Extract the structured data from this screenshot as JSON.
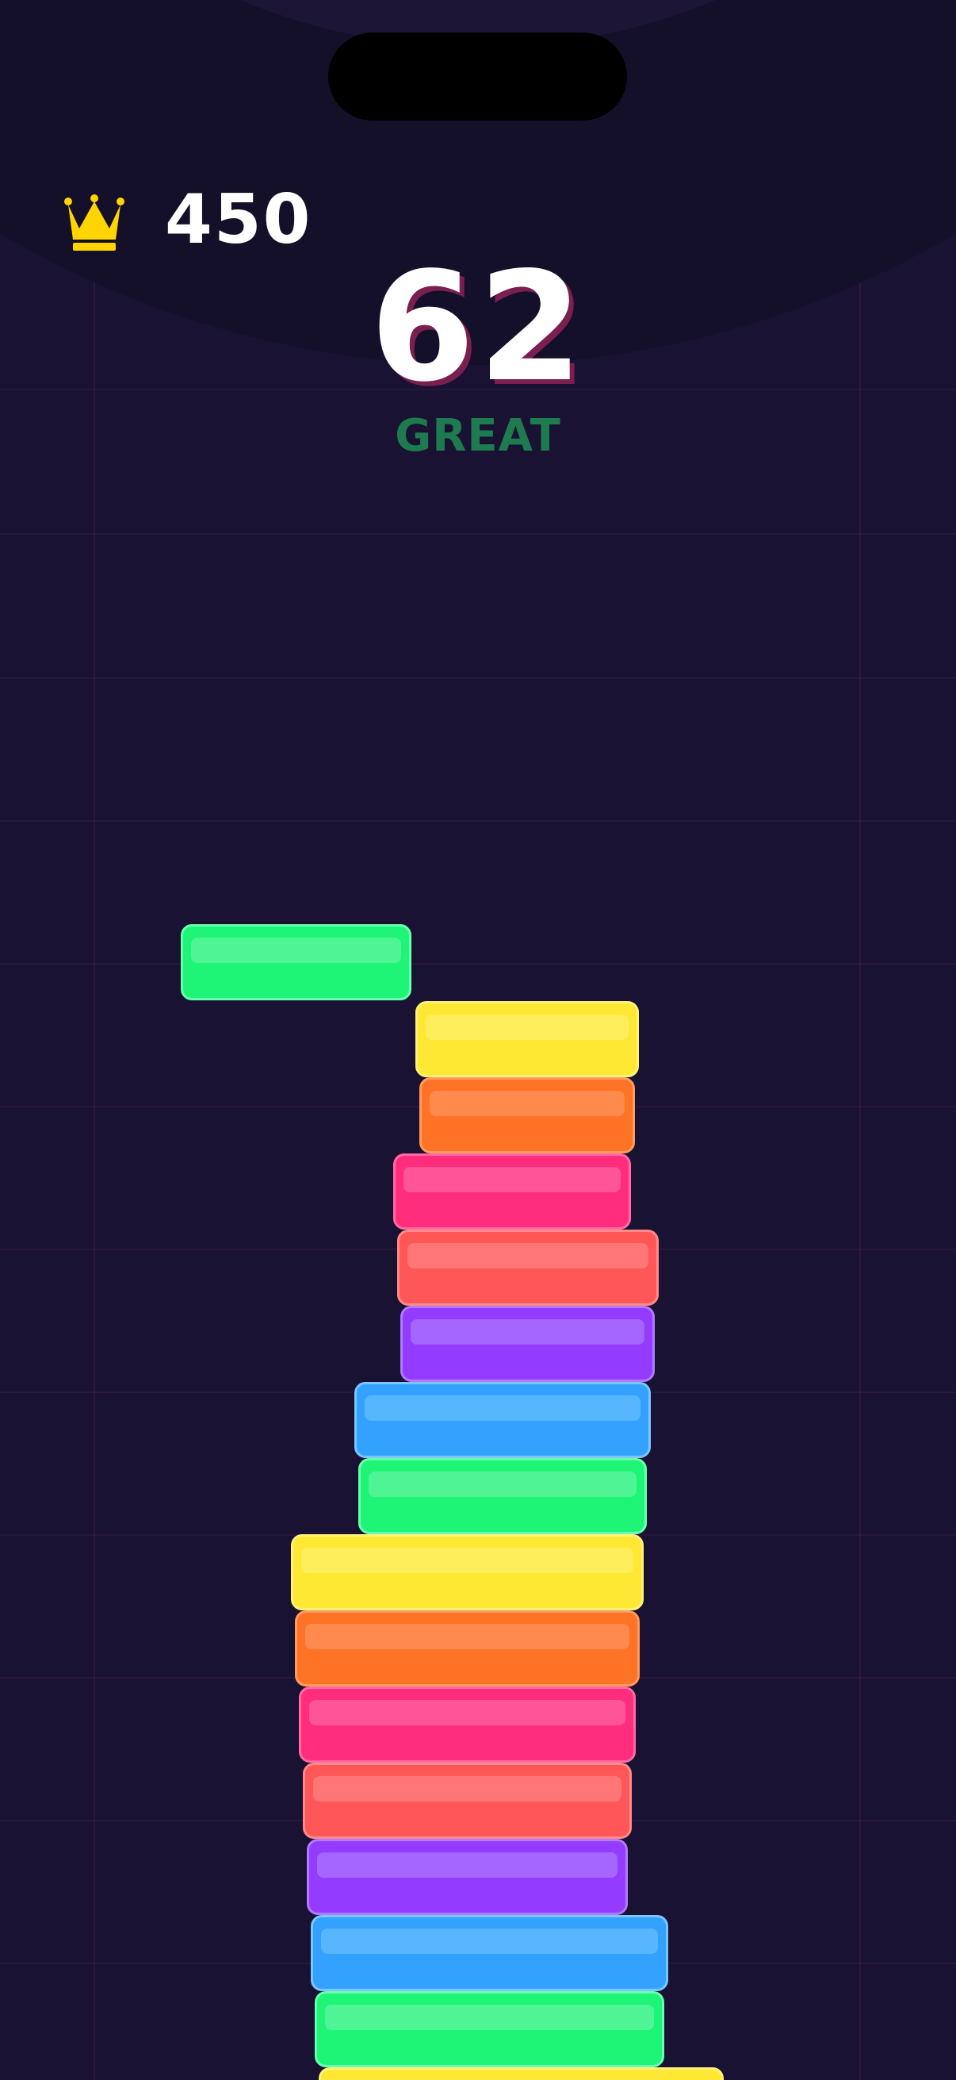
{
  "hud": {
    "best_score": "450",
    "current_score": "62",
    "feedback": "GREAT",
    "best_icon": "crown-icon"
  },
  "colors": {
    "background": "#1a1232",
    "crown": "#ffd400",
    "feedback_text": "#1e7a4f",
    "score_shadow": "#7a1f4f"
  },
  "palette": {
    "green": {
      "fill": "#1ef577",
      "shine": "#4ff595",
      "border": "#6affb0"
    },
    "yellow": {
      "fill": "#ffe834",
      "shine": "#ffee5c",
      "border": "#fff27a"
    },
    "orange": {
      "fill": "#ff7326",
      "shine": "#ff8a4e",
      "border": "#ff9a60"
    },
    "pink": {
      "fill": "#ff2d7c",
      "shine": "#ff5496",
      "border": "#ff6aa4"
    },
    "coral": {
      "fill": "#ff5757",
      "shine": "#ff7676",
      "border": "#ff8a8a"
    },
    "purple": {
      "fill": "#933bff",
      "shine": "#a565ff",
      "border": "#b27aff"
    },
    "blue": {
      "fill": "#33a2ff",
      "shine": "#58b6ff",
      "border": "#7ac6ff"
    }
  },
  "moving_block": {
    "color": "green"
  },
  "stack_colors_top_to_bottom": [
    "yellow",
    "orange",
    "pink",
    "coral",
    "purple",
    "blue",
    "green",
    "yellow",
    "orange",
    "pink",
    "coral",
    "purple",
    "blue",
    "green",
    "yellow"
  ]
}
